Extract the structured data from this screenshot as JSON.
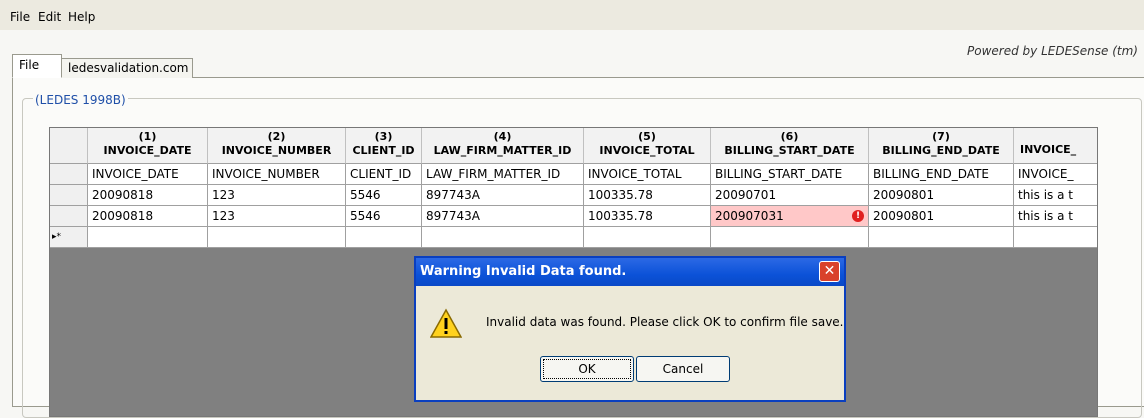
{
  "menu": [
    "File",
    "Edit",
    "Help"
  ],
  "powered_by": "Powered by LEDESense (tm)",
  "tabs": [
    "File",
    "ledesvalidation.com"
  ],
  "group_title": "(LEDES 1998B)",
  "table": {
    "columns": [
      {
        "num": "(1)",
        "name": "INVOICE_DATE"
      },
      {
        "num": "(2)",
        "name": "INVOICE_NUMBER"
      },
      {
        "num": "(3)",
        "name": "CLIENT_ID"
      },
      {
        "num": "(4)",
        "name": "LAW_FIRM_MATTER_ID"
      },
      {
        "num": "(5)",
        "name": "INVOICE_TOTAL"
      },
      {
        "num": "(6)",
        "name": "BILLING_START_DATE"
      },
      {
        "num": "(7)",
        "name": "BILLING_END_DATE"
      },
      {
        "num": "",
        "name": "INVOICE_"
      }
    ],
    "rows": [
      [
        "INVOICE_DATE",
        "INVOICE_NUMBER",
        "CLIENT_ID",
        "LAW_FIRM_MATTER_ID",
        "INVOICE_TOTAL",
        "BILLING_START_DATE",
        "BILLING_END_DATE",
        "INVOICE_"
      ],
      [
        "20090818",
        "123",
        "5546",
        "897743A",
        "100335.78",
        "20090701",
        "20090801",
        "this is a t"
      ],
      [
        "20090818",
        "123",
        "5546",
        "897743A",
        "100335.78",
        "200907031",
        "20090801",
        "this is a t"
      ]
    ],
    "new_row_marker": "▸*",
    "invalid_cell_error": "!"
  },
  "dialog": {
    "title": "Warning Invalid Data found.",
    "message": "Invalid data was found. Please click OK to confirm file save.",
    "ok_label": "OK",
    "cancel_label": "Cancel",
    "close_glyph": "✕",
    "icon": "warning-icon"
  },
  "colors": {
    "invalid_cell": "#ffc8c8",
    "titlebar": "#0b52d8",
    "group_title": "#1f4fa8"
  }
}
